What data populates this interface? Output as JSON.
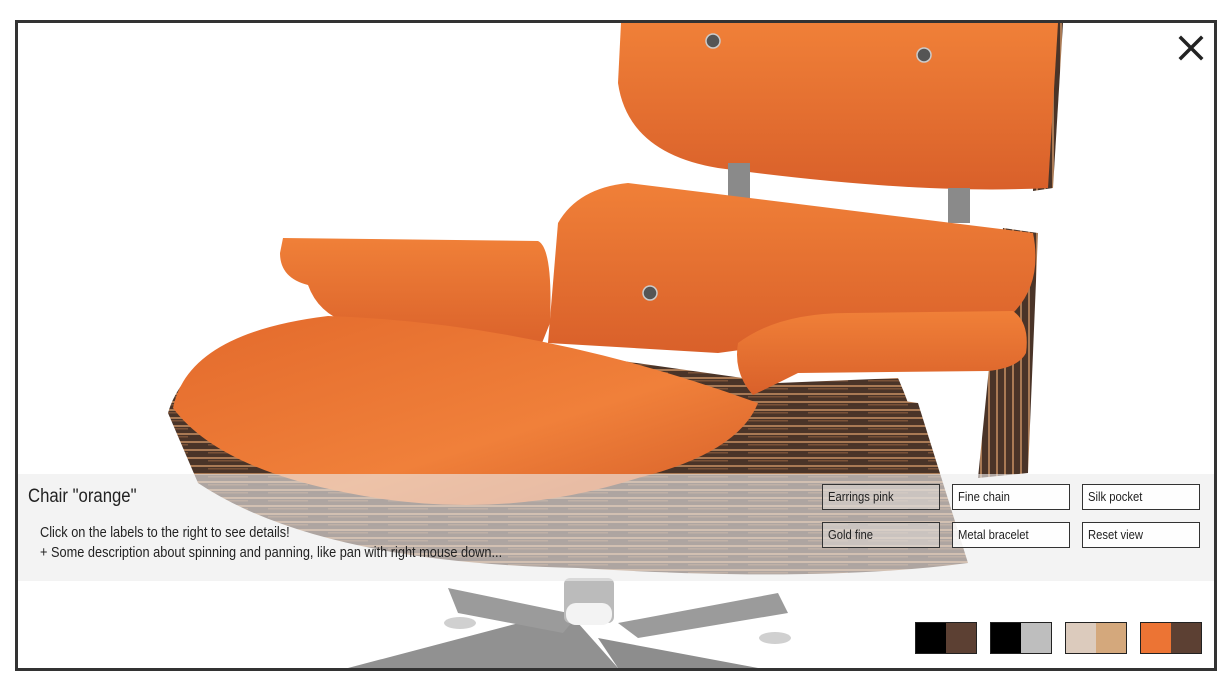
{
  "viewer": {
    "title": "Chair \"orange\"",
    "description_lines": [
      "Click on the labels to the right to see details!",
      "+ Some description about spinning and panning, like pan with right mouse down..."
    ],
    "close_icon": "close-icon",
    "model": "lounge-chair-3d-model"
  },
  "labels": [
    {
      "label": "Earrings pink"
    },
    {
      "label": "Fine chain"
    },
    {
      "label": "Silk pocket"
    },
    {
      "label": "Gold fine"
    },
    {
      "label": "Metal bracelet"
    },
    {
      "label": "Reset view"
    }
  ],
  "swatches": [
    {
      "name": "black-brown",
      "colors": [
        "#000000",
        "#5c4033"
      ]
    },
    {
      "name": "black-gray",
      "colors": [
        "#000000",
        "#bebebe"
      ]
    },
    {
      "name": "beige-tan",
      "colors": [
        "#dccbbd",
        "#d4a87c"
      ]
    },
    {
      "name": "orange-brown",
      "colors": [
        "#ec7434",
        "#5c4033"
      ]
    }
  ],
  "colors": {
    "frame_border": "#333333",
    "leather": "#ec7434",
    "wood_dark": "#4a3428",
    "wood_light": "#a97a55",
    "metal": "#8e8e8e"
  }
}
